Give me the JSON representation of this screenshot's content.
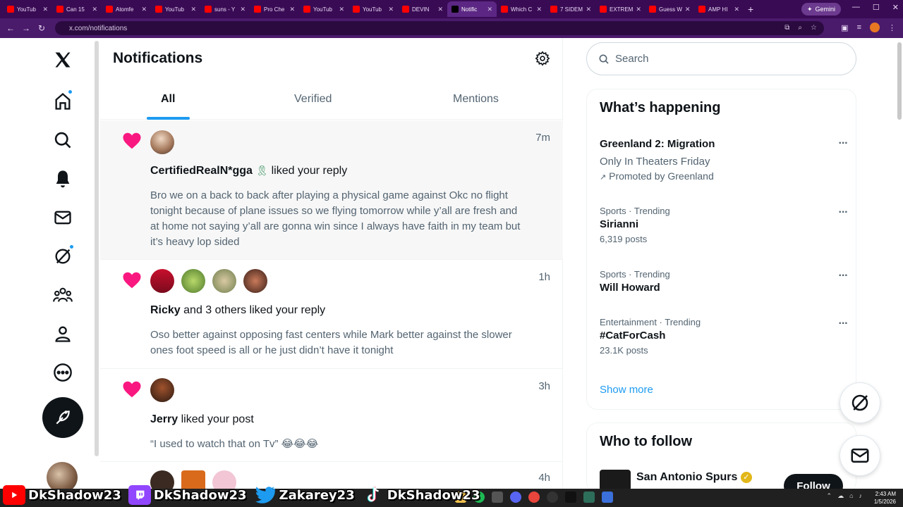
{
  "browser": {
    "tabs": [
      {
        "label": "YouTub",
        "color": "#ff0000"
      },
      {
        "label": "Can 15",
        "color": "#ff0000"
      },
      {
        "label": "Atomfe",
        "color": "#ff0000"
      },
      {
        "label": "YouTub",
        "color": "#ff0000"
      },
      {
        "label": "suns - Y",
        "color": "#ff0000"
      },
      {
        "label": "Pro Che",
        "color": "#ff0000"
      },
      {
        "label": "YouTub",
        "color": "#ff0000"
      },
      {
        "label": "YouTub",
        "color": "#ff0000"
      },
      {
        "label": "DEVIN",
        "color": "#ff0000"
      },
      {
        "label": "Notific",
        "color": "#000000",
        "active": true
      },
      {
        "label": "Which C",
        "color": "#ff0000"
      },
      {
        "label": "7 SIDEM",
        "color": "#ff0000"
      },
      {
        "label": "EXTREM",
        "color": "#ff0000"
      },
      {
        "label": "Guess W",
        "color": "#ff0000"
      },
      {
        "label": "AMP HI",
        "color": "#ff0000"
      }
    ],
    "new_tab": "+",
    "gemini_label": "Gemini",
    "url": "x.com/notifications"
  },
  "main": {
    "title": "Notifications",
    "tabs": [
      "All",
      "Verified",
      "Mentions"
    ],
    "active_tab": "All"
  },
  "notifications": [
    {
      "user": "CertifiedRealN*gga",
      "action": " liked your reply",
      "time": "7m",
      "body": "Bro we on a back to back after playing a physical game against Okc no flight tonight because of plane issues so we flying tomorrow while y’all are fresh and at home not saying y’all are gonna win since I always have faith in my team but it’s heavy lop sided"
    },
    {
      "user": "Ricky",
      "action": " and 3 others liked your reply",
      "time": "1h",
      "body": "Oso better against opposing fast centers while Mark better against the slower ones foot speed is all or he just didn’t have it tonight"
    },
    {
      "user": "Jerry",
      "action": " liked your post",
      "time": "3h",
      "body": "“I used to watch that on Tv” 😂😂😂"
    },
    {
      "time": "4h"
    }
  ],
  "sidebar": {
    "search_placeholder": "Search",
    "whats_happening_title": "What’s happening",
    "promoted": {
      "name": "Greenland 2: Migration",
      "tagline": "Only In Theaters Friday",
      "promoted_by": "Promoted by Greenland"
    },
    "trends": [
      {
        "meta": "Sports · Trending",
        "name": "Sirianni",
        "posts": "6,319 posts"
      },
      {
        "meta": "Sports · Trending",
        "name": "Will Howard",
        "posts": ""
      },
      {
        "meta": "Entertainment · Trending",
        "name": "#CatForCash",
        "posts": "23.1K posts"
      }
    ],
    "show_more": "Show more",
    "who_to_follow_title": "Who to follow",
    "follow_suggestion": {
      "name": "San Antonio Spurs",
      "button": "Follow"
    }
  },
  "overlay": {
    "handles": [
      "DkShadow23",
      "DkShadow23",
      "Zakarey23",
      "DkShadow23"
    ]
  },
  "clock": {
    "time": "2:43 AM",
    "date": "1/5/2026"
  },
  "colors": {
    "accent": "#1d9bf0",
    "like": "#f91880",
    "browser_tabbar": "#3a0b55"
  }
}
